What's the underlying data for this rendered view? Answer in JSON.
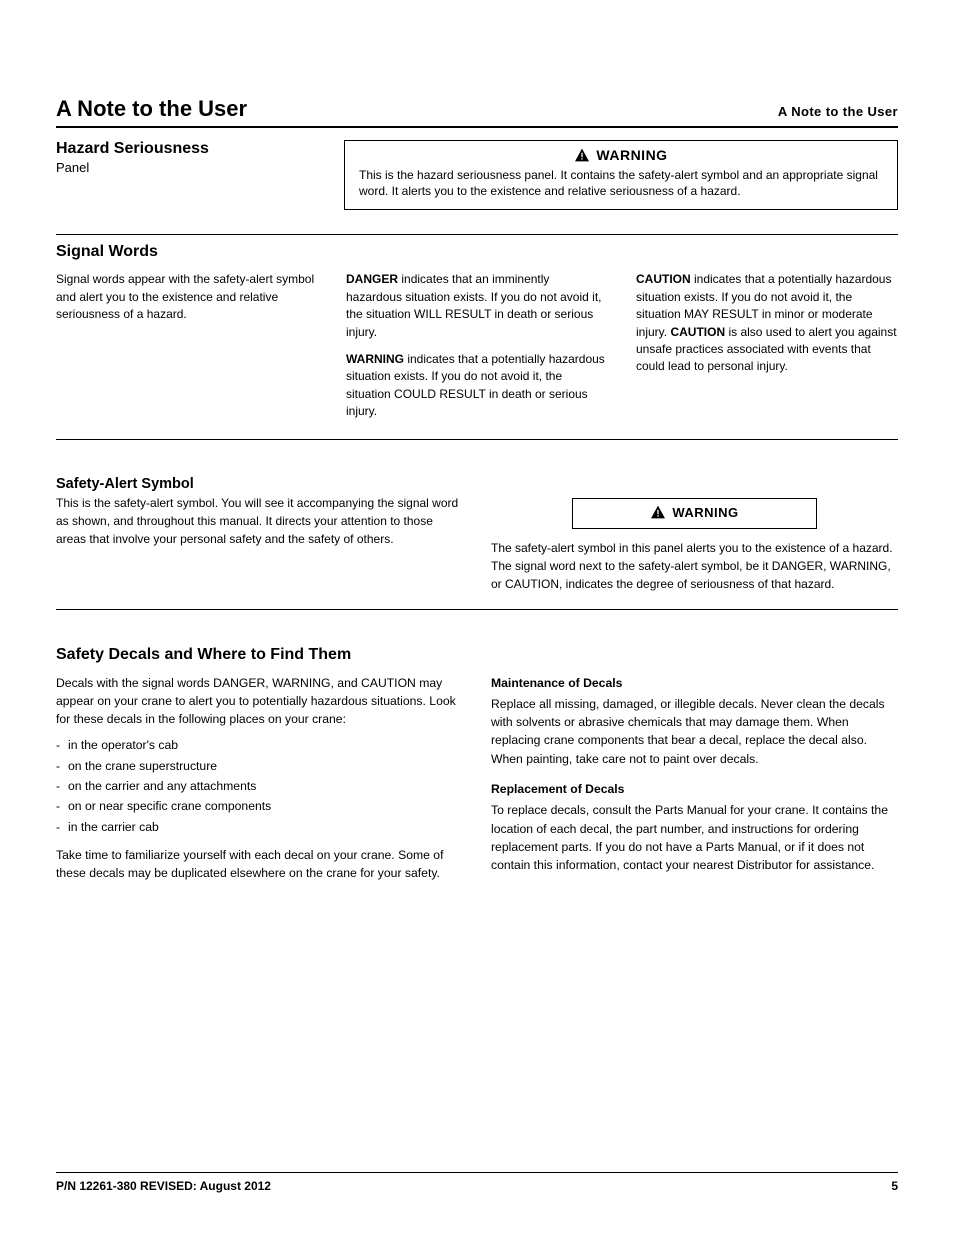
{
  "breadcrumb": "A Note to the User",
  "section1": {
    "title": "A Note to the User",
    "left_title": "Hazard Seriousness",
    "left_sub": "Panel",
    "warn_label": "WARNING",
    "warn_body": "This is the hazard seriousness panel. It contains the safety-alert symbol and an appropriate signal word. It alerts you to the existence and relative seriousness of a hazard."
  },
  "section2": {
    "title": "Signal Words",
    "col1": "Signal words appear with the safety-alert symbol and alert you to the existence and relative seriousness of a hazard.",
    "col2a": "DANGER",
    "col2at": " indicates that an imminently hazardous situation exists. If you do not avoid it, the situation WILL RESULT in death or serious injury.",
    "col2b": "WARNING",
    "col2bt": " indicates that a potentially hazardous situation exists. If you do not avoid it, the situation COULD RESULT in death or serious injury.",
    "col3a": "CAUTION",
    "col3at": " indicates that a potentially hazardous situation exists. If you do not avoid it, the situation MAY RESULT in minor or moderate injury. ",
    "col3a2": "CAUTION",
    "col3a2t": " is also used to alert you against unsafe practices associated with events that could lead to personal injury."
  },
  "section3": {
    "head": "Safety-Alert Symbol",
    "p1": "This is the safety-alert symbol. You will see it accompanying the signal word as shown, and throughout this manual. It directs your attention to those areas that involve your personal safety and the safety of others.",
    "box_label": "WARNING",
    "after": "The safety-alert symbol in this panel alerts you to the existence of a hazard. The signal word next to the safety-alert symbol, be it DANGER, WARNING, or CAUTION, indicates the degree of seriousness of that hazard."
  },
  "decals": {
    "title": "Safety Decals and Where to Find Them",
    "intro": "Decals with the signal words DANGER, WARNING, and CAUTION may appear on your crane to alert you to potentially hazardous situations. Look for these decals in the following places on your crane:",
    "locs": [
      "in the operator's cab",
      "on the crane superstructure",
      "on the carrier and any attachments",
      "on or near specific crane components",
      "in the carrier cab"
    ],
    "col1p2": "Take time to familiarize yourself with each decal on your crane. Some of these decals may be duplicated elsewhere on the crane for your safety.",
    "col2_head": "Maintenance of Decals",
    "col2_p1": "Replace all missing, damaged, or illegible decals. Never clean the decals with solvents or abrasive chemicals that may damage them. When replacing crane components that bear a decal, replace the decal also. When painting, take care not to paint over decals.",
    "col2_head2": "Replacement of Decals",
    "col2_p2": "To replace decals, consult the Parts Manual for your crane. It contains the location of each decal, the part number, and instructions for ordering replacement parts. If you do not have a Parts Manual, or if it does not contain this information, contact your nearest Distributor for assistance."
  },
  "footer": {
    "left": "P/N 12261-380  REVISED: August 2012",
    "right": "5"
  }
}
